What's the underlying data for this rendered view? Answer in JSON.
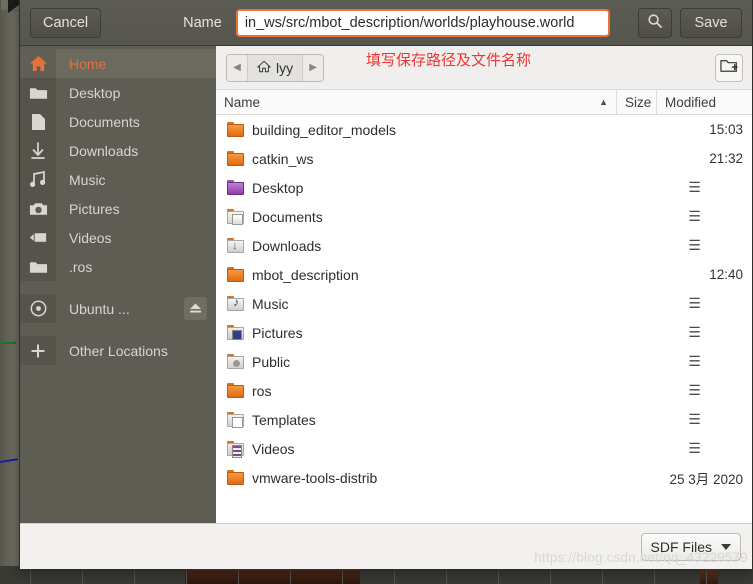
{
  "dialog": {
    "cancel_label": "Cancel",
    "name_label": "Name",
    "name_value": "in_ws/src/mbot_description/worlds/playhouse.world",
    "search_icon": "search-icon",
    "save_label": "Save"
  },
  "annotation": {
    "text": "填写保存路径及文件名称",
    "color": "#f03535"
  },
  "pathbar": {
    "back_glyph": "◀",
    "forward_glyph": "▶",
    "current_crumb": "lyy",
    "home_icon": "home-icon",
    "new_folder_icon": "new-folder-icon"
  },
  "sidebar": {
    "items": [
      {
        "label": "Home",
        "icon": "home-icon",
        "selected": true
      },
      {
        "label": "Desktop",
        "icon": "folder-icon",
        "selected": false
      },
      {
        "label": "Documents",
        "icon": "document-icon",
        "selected": false
      },
      {
        "label": "Downloads",
        "icon": "download-icon",
        "selected": false
      },
      {
        "label": "Music",
        "icon": "music-note-icon",
        "selected": false
      },
      {
        "label": "Pictures",
        "icon": "camera-icon",
        "selected": false
      },
      {
        "label": "Videos",
        "icon": "video-camera-icon",
        "selected": false
      },
      {
        "label": ".ros",
        "icon": "folder-icon",
        "selected": false
      },
      {
        "label": "Ubuntu ...",
        "icon": "disc-icon",
        "selected": false,
        "eject": true,
        "eject_icon": "eject-icon"
      },
      {
        "label": "Other Locations",
        "icon": "plus-icon",
        "selected": false
      }
    ]
  },
  "columns": {
    "name": "Name",
    "size": "Size",
    "modified": "Modified",
    "sort_arrow": "▲"
  },
  "files": [
    {
      "name": "building_editor_models",
      "icon": "folder-plain-icon",
      "kind": "plain",
      "size": "",
      "modified": "15:03",
      "menu": false
    },
    {
      "name": "catkin_ws",
      "icon": "folder-plain-icon",
      "kind": "plain",
      "size": "",
      "modified": "21:32",
      "menu": false
    },
    {
      "name": "Desktop",
      "icon": "folder-desktop-icon",
      "kind": "desktop",
      "size": "",
      "modified": "☰",
      "menu": true
    },
    {
      "name": "Documents",
      "icon": "folder-documents-icon",
      "kind": "docs",
      "size": "",
      "modified": "☰",
      "menu": true
    },
    {
      "name": "Downloads",
      "icon": "folder-downloads-icon",
      "kind": "dl",
      "size": "",
      "modified": "☰",
      "menu": true
    },
    {
      "name": "mbot_description",
      "icon": "folder-plain-icon",
      "kind": "plain",
      "size": "",
      "modified": "12:40",
      "menu": false
    },
    {
      "name": "Music",
      "icon": "folder-music-icon",
      "kind": "music",
      "size": "",
      "modified": "☰",
      "menu": true
    },
    {
      "name": "Pictures",
      "icon": "folder-pictures-icon",
      "kind": "pics",
      "size": "",
      "modified": "☰",
      "menu": true
    },
    {
      "name": "Public",
      "icon": "folder-public-icon",
      "kind": "public",
      "size": "",
      "modified": "☰",
      "menu": true
    },
    {
      "name": "ros",
      "icon": "folder-plain-icon",
      "kind": "plain",
      "size": "",
      "modified": "☰",
      "menu": true
    },
    {
      "name": "Templates",
      "icon": "folder-templates-icon",
      "kind": "templ",
      "size": "",
      "modified": "☰",
      "menu": true
    },
    {
      "name": "Videos",
      "icon": "folder-videos-icon",
      "kind": "video",
      "size": "",
      "modified": "☰",
      "menu": true
    },
    {
      "name": "vmware-tools-distrib",
      "icon": "folder-plain-icon",
      "kind": "plain",
      "size": "",
      "modified": "25 3月 2020",
      "menu": false
    }
  ],
  "footer": {
    "filter_label": "SDF Files",
    "filter_caret": "chevron-down-icon"
  },
  "watermark": {
    "text": "https://blog.csdn.net/qq_43229579"
  }
}
